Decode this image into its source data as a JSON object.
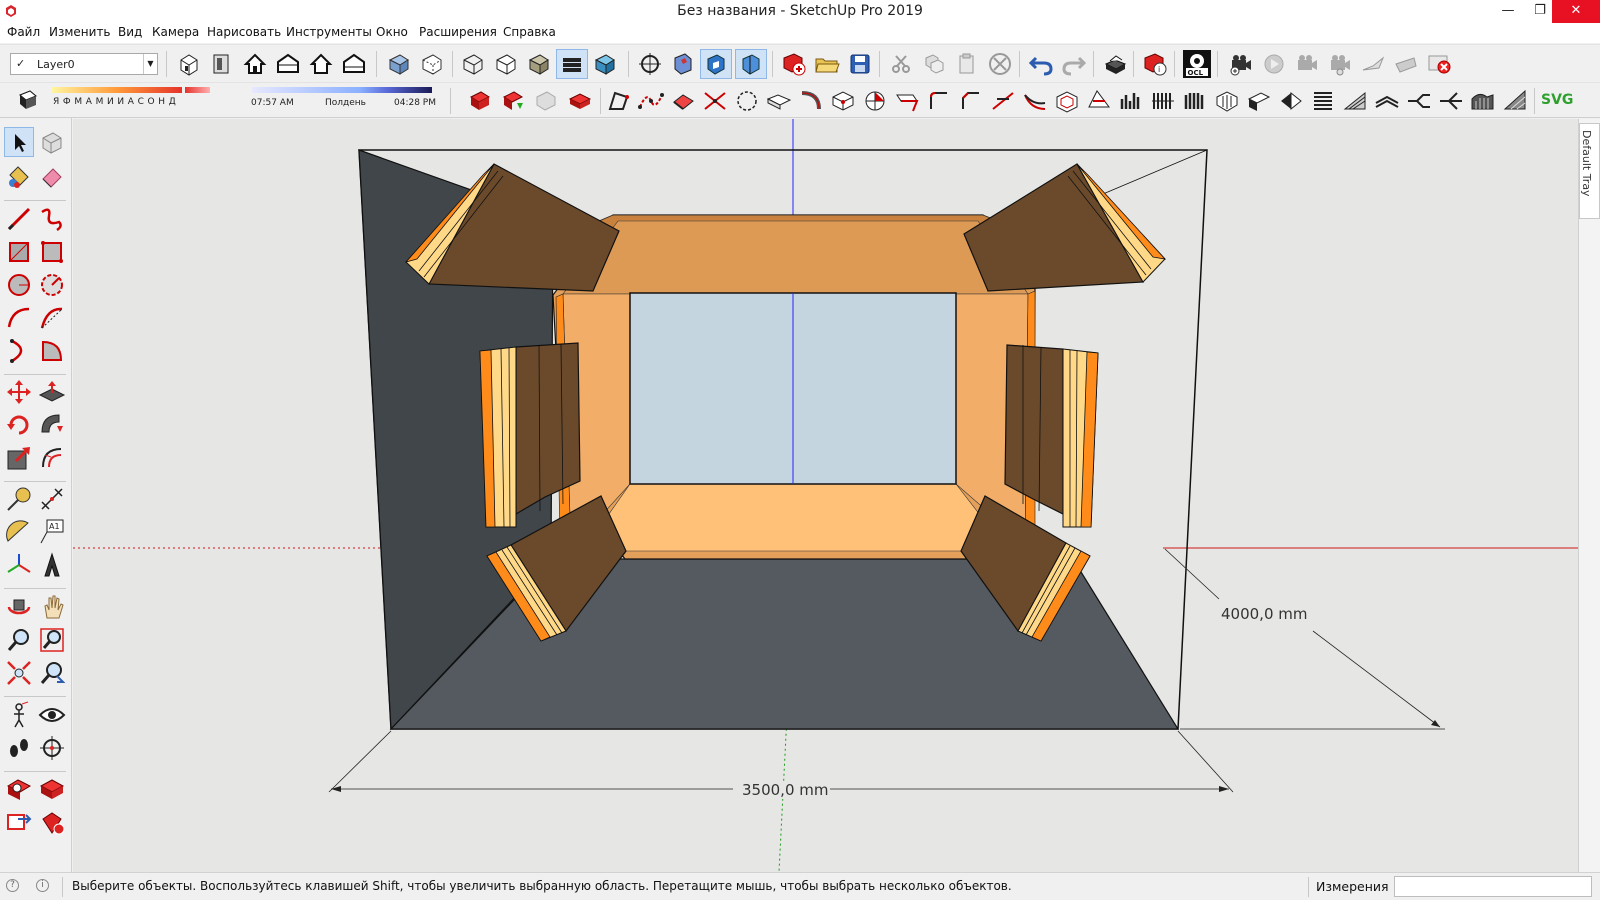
{
  "window": {
    "title": "Без названия - SketchUp Pro 2019",
    "controls": [
      "minimize-icon",
      "restore-icon",
      "close-icon"
    ]
  },
  "menu": [
    "Файл",
    "Изменить",
    "Вид",
    "Камера",
    "Нарисовать",
    "Инструменты",
    "Окно",
    "Расширения",
    "Справка"
  ],
  "layer": {
    "current": "Layer0"
  },
  "shadows": {
    "months": "Я Ф М А М И И А С О Н Д",
    "time_start": "07:57 AM",
    "time_mid": "Полдень",
    "time_end": "04:28 PM"
  },
  "toolbar_end_label": "SVG",
  "tray": {
    "label": "Default Tray"
  },
  "viewport": {
    "dimension_width": "3500,0 mm",
    "dimension_depth": "4000,0 mm",
    "colors": {
      "wall_dark": "#40464a",
      "floor": "#545a60",
      "panel_brown": "#6b4a2c",
      "panel_orange": "#f5a860",
      "window_glass": "#c5d5df",
      "edge_orange": "#ff8c1a",
      "edge_light": "#ffd888"
    }
  },
  "statusbar": {
    "message": "Выберите объекты. Воспользуйтесь клавишей Shift, чтобы увеличить выбранную область. Перетащите мышь, чтобы выбрать несколько объектов.",
    "measurements_label": "Измерения",
    "measurements_value": ""
  }
}
